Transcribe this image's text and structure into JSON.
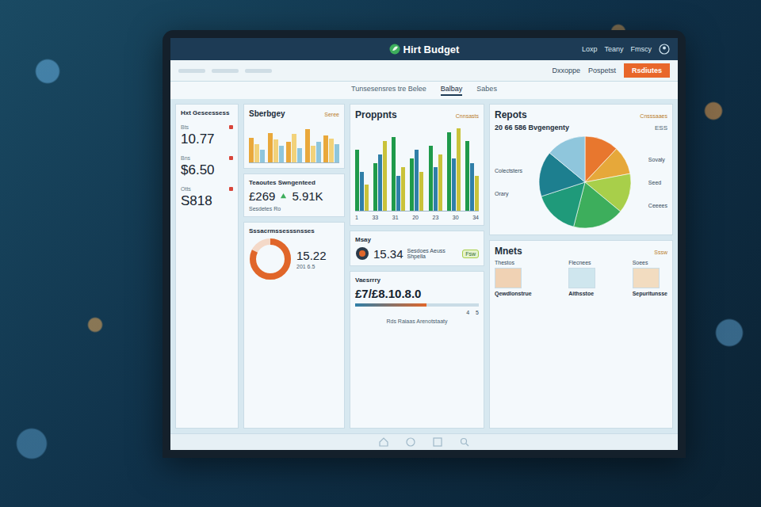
{
  "window": {
    "title": "Hirt Budget"
  },
  "top_links": [
    "Loxp",
    "Teany",
    "Fmscy"
  ],
  "actions": [
    "Dxxoppe",
    "Pospetst"
  ],
  "primary_button": "Rsdiutes",
  "subnav": [
    {
      "label": "Tunsesensres tre Belee",
      "selected": false
    },
    {
      "label": "Balbay",
      "selected": true
    },
    {
      "label": "Sabes",
      "selected": false
    }
  ],
  "sidebar": {
    "title": "Hxt Geseessess",
    "items": [
      {
        "label": "Bts",
        "value": "10.77",
        "color": "#d8453a"
      },
      {
        "label": "Bns",
        "value": "$6.50",
        "color": "#d8453a"
      },
      {
        "label": "Otts",
        "value": "S818",
        "color": "#d8453a"
      }
    ]
  },
  "budget": {
    "title": "Sberbgey",
    "link": "Seree",
    "max": 100,
    "series": [
      {
        "color": "#e9a83b",
        "values": [
          60,
          72,
          50,
          80,
          65
        ]
      },
      {
        "color": "#f2d27a",
        "values": [
          45,
          55,
          70,
          40,
          58
        ]
      },
      {
        "color": "#8fc6dc",
        "values": [
          30,
          40,
          35,
          50,
          45
        ]
      }
    ]
  },
  "savings": {
    "title": "Teaoutes Swngenteed",
    "value": "£269",
    "value2": "5.91K",
    "caption": "Sesdetes Ro"
  },
  "ring": {
    "title": "Sssacrmssesssnsses",
    "level": 0.82,
    "color": "#e0662a",
    "value": "15.22",
    "sub": "201 6.5"
  },
  "projects": {
    "title": "Proppnts",
    "link": "Cnnsasts",
    "max": 100,
    "ticks": [
      "1",
      "33",
      "31",
      "20",
      "23",
      "30",
      "34"
    ],
    "series": [
      {
        "color": "#1f9a4a",
        "values": [
          70,
          55,
          85,
          60,
          75,
          90,
          80
        ]
      },
      {
        "color": "#2f7fa8",
        "values": [
          45,
          65,
          40,
          70,
          50,
          60,
          55
        ]
      },
      {
        "color": "#c9c23a",
        "values": [
          30,
          80,
          50,
          45,
          65,
          95,
          40
        ]
      }
    ]
  },
  "msay": {
    "title": "Msay",
    "value": "15.34",
    "desc": "Sesdoes Aeuss Shpella",
    "badge": "Fsw"
  },
  "variance": {
    "title": "Vaesrrry",
    "value": "£7/£8.10.8.0",
    "level": 0.58,
    "ticks": [
      "4",
      "5"
    ],
    "caption": "Rds Raiaas Arenotstaaty"
  },
  "reports": {
    "title": "Repots",
    "link": "Cnsssaaes",
    "subtitle": "20 66 586 Bvgengenty",
    "count": "ESS",
    "labels": [
      "Colectsters",
      "Orary",
      "Sovaly",
      "Seed",
      "Ceeees"
    ],
    "slices": [
      {
        "value": 12,
        "color": "#e8772e"
      },
      {
        "value": 10,
        "color": "#e6a83a"
      },
      {
        "value": 14,
        "color": "#a8cf4a"
      },
      {
        "value": 18,
        "color": "#3dae5c"
      },
      {
        "value": 16,
        "color": "#1f9a7a"
      },
      {
        "value": 16,
        "color": "#1d7f8f"
      },
      {
        "value": 14,
        "color": "#8fc6dc"
      }
    ]
  },
  "mnets": {
    "title": "Mnets",
    "link": "Sssw",
    "tiles": [
      {
        "label": "Thestos",
        "caption": "Qewdlonstrue",
        "color": "#f0d2b4"
      },
      {
        "label": "Flecnees",
        "caption": "Aithsstoe",
        "color": "#cfe6ee"
      },
      {
        "label": "Soees",
        "caption": "Sepuritunsse",
        "color": "#f2dcc0"
      }
    ]
  }
}
